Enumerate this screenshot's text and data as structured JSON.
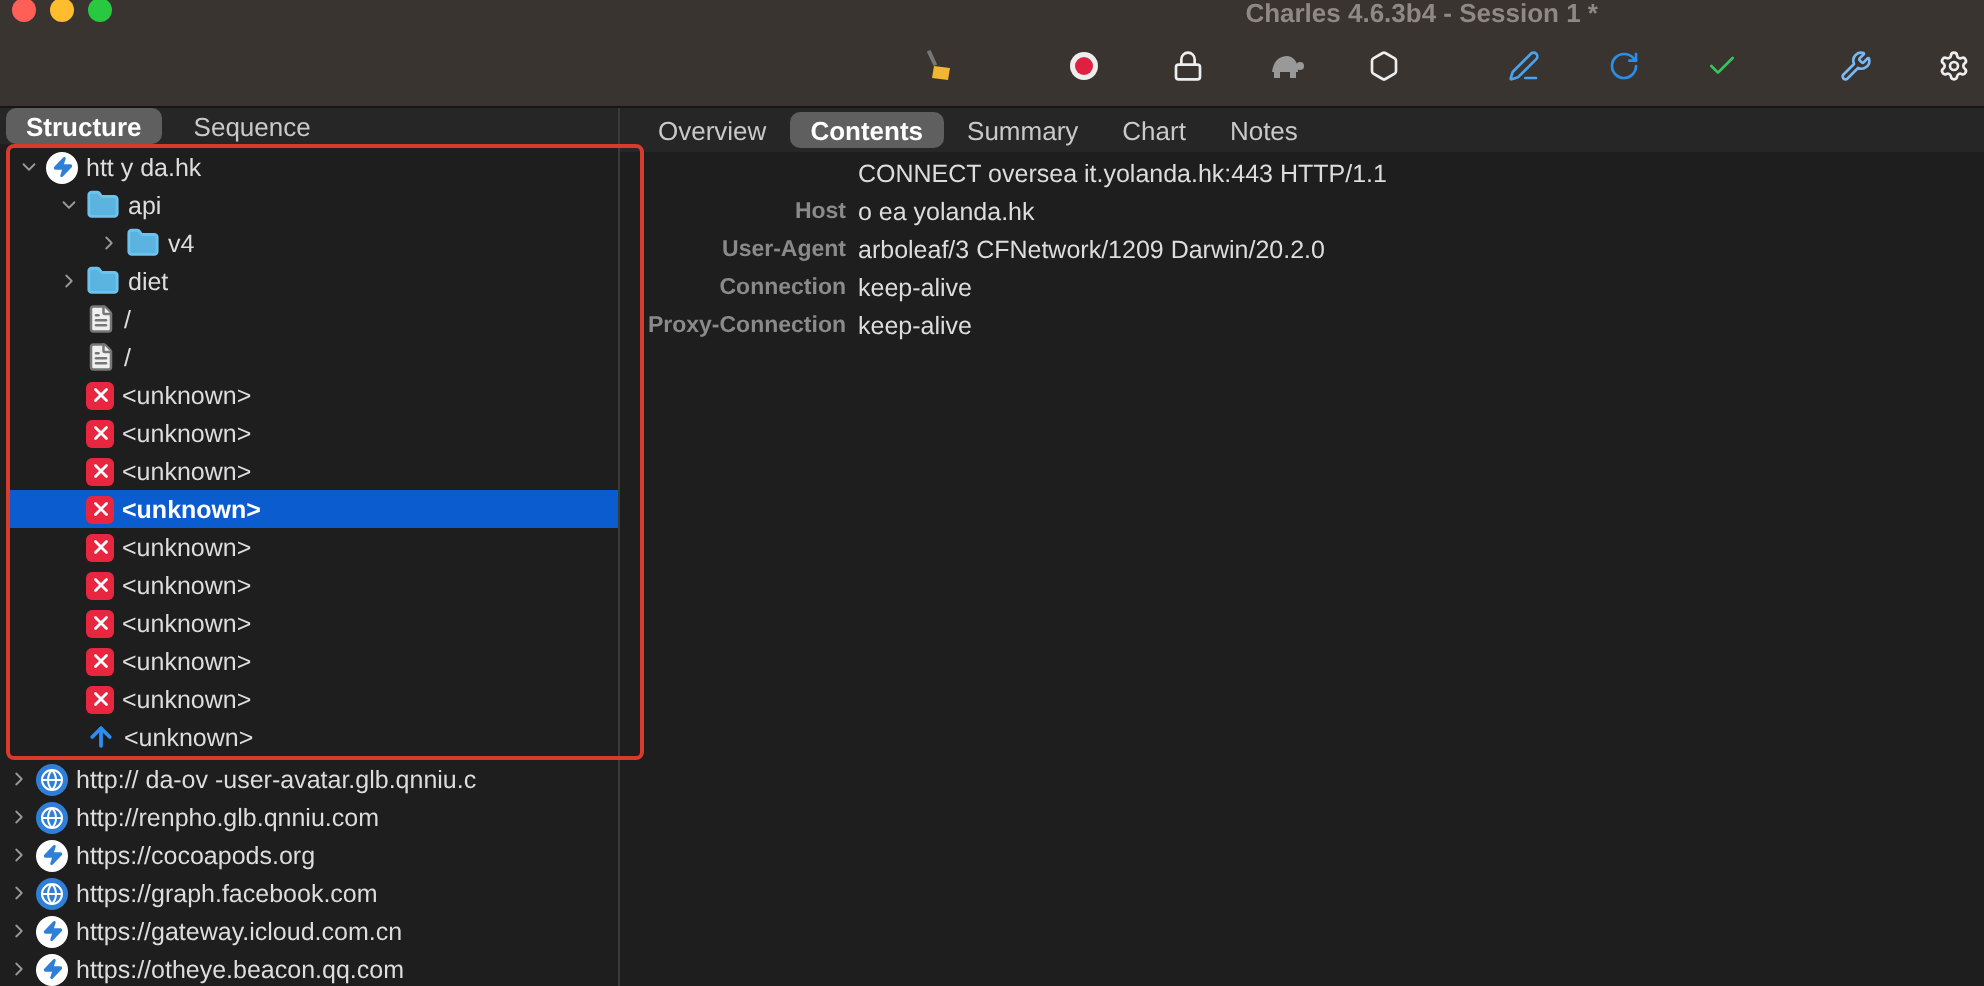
{
  "window": {
    "title": "Charles 4.6.3b4 - Session 1 *"
  },
  "toolbar": [
    {
      "kind": "broom"
    },
    {
      "kind": "record",
      "on": true
    },
    {
      "kind": "lock"
    },
    {
      "kind": "turtle"
    },
    {
      "kind": "stop"
    },
    {
      "kind": "pen"
    },
    {
      "kind": "refresh"
    },
    {
      "kind": "check"
    },
    {
      "kind": "tools"
    },
    {
      "kind": "gear"
    }
  ],
  "left_tabs": [
    {
      "label": "Structure",
      "selected": true
    },
    {
      "label": "Sequence",
      "selected": false
    }
  ],
  "tree": [
    {
      "label": "htt y da.hk",
      "kind": "host-secure",
      "expanded": true,
      "selected": false,
      "children": [
        {
          "label": "api",
          "kind": "folder",
          "expanded": true,
          "selected": false,
          "children": [
            {
              "label": "v4",
              "kind": "folder",
              "expanded": false,
              "selected": false
            }
          ]
        },
        {
          "label": "diet",
          "kind": "folder",
          "expanded": false,
          "selected": false
        },
        {
          "label": "/",
          "kind": "file",
          "selected": false
        },
        {
          "label": "/",
          "kind": "file",
          "selected": false
        },
        {
          "label": "<unknown>",
          "kind": "error",
          "selected": false
        },
        {
          "label": "<unknown>",
          "kind": "error",
          "selected": false
        },
        {
          "label": "<unknown>",
          "kind": "error",
          "selected": false
        },
        {
          "label": "<unknown>",
          "kind": "error",
          "selected": true
        },
        {
          "label": "<unknown>",
          "kind": "error",
          "selected": false
        },
        {
          "label": "<unknown>",
          "kind": "error",
          "selected": false
        },
        {
          "label": "<unknown>",
          "kind": "error",
          "selected": false
        },
        {
          "label": "<unknown>",
          "kind": "error",
          "selected": false
        },
        {
          "label": "<unknown>",
          "kind": "error",
          "selected": false
        },
        {
          "label": "<unknown>",
          "kind": "upload",
          "selected": false
        }
      ]
    },
    {
      "label": "http:// da-ov -user-avatar.glb.qnniu.c",
      "kind": "host-web",
      "expanded": false,
      "selected": false
    },
    {
      "label": "http://renpho.glb.qnniu.com",
      "kind": "host-web",
      "expanded": false,
      "selected": false
    },
    {
      "label": "https://cocoapods.org",
      "kind": "host-secure",
      "expanded": false,
      "selected": false
    },
    {
      "label": "https://graph.facebook.com",
      "kind": "host-web",
      "expanded": false,
      "selected": false
    },
    {
      "label": "https://gateway.icloud.com.cn",
      "kind": "host-secure",
      "expanded": false,
      "selected": false
    },
    {
      "label": "https://otheye.beacon.qq.com",
      "kind": "host-secure",
      "expanded": false,
      "selected": false
    }
  ],
  "right_tabs": [
    {
      "label": "Overview",
      "selected": false
    },
    {
      "label": "Contents",
      "selected": true
    },
    {
      "label": "Summary",
      "selected": false
    },
    {
      "label": "Chart",
      "selected": false
    },
    {
      "label": "Notes",
      "selected": false
    }
  ],
  "request_line": "CONNECT oversea it.yolanda.hk:443 HTTP/1.1",
  "headers": [
    {
      "name": "Host",
      "value": "o ea yolanda.hk"
    },
    {
      "name": "User-Agent",
      "value": "arboleaf/3 CFNetwork/1209 Darwin/20.2.0"
    },
    {
      "name": "Connection",
      "value": "keep-alive"
    },
    {
      "name": "Proxy-Connection",
      "value": "keep-alive"
    }
  ]
}
